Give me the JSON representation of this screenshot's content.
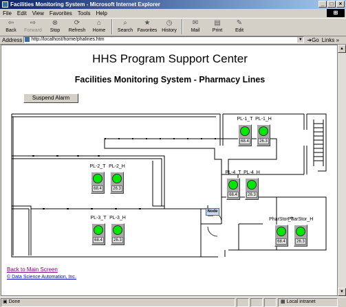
{
  "window": {
    "title": "Facilities Monitoring System - Microsoft Internet Explorer"
  },
  "menu": [
    "File",
    "Edit",
    "View",
    "Favorites",
    "Tools",
    "Help"
  ],
  "toolbar": {
    "back": "Back",
    "forward": "Forward",
    "stop": "Stop",
    "refresh": "Refresh",
    "home": "Home",
    "search": "Search",
    "favorites": "Favorites",
    "history": "History",
    "mail": "Mail",
    "print": "Print",
    "edit": "Edit"
  },
  "address": {
    "label": "Address",
    "url": "http://localhost/home/phalines.htm",
    "go": "Go",
    "links": "Links »"
  },
  "page": {
    "title": "HHS Program Support Center",
    "subtitle": "Facilities Monitoring System - Pharmacy Lines",
    "suspend_label": "Suspend Alarm",
    "node_label": "Node",
    "back_link": "Back to Main Screen",
    "copyright": "© Data Science Automation, Inc."
  },
  "sensors": [
    {
      "label": "PL-1_T",
      "value": "68.4",
      "status": "ok"
    },
    {
      "label": "PL-1_H",
      "value": "26.3",
      "status": "ok"
    },
    {
      "label": "PL-2_T",
      "value": "68.4",
      "status": "ok"
    },
    {
      "label": "PL-2_H",
      "value": "26.3",
      "status": "ok"
    },
    {
      "label": "PL-4_T",
      "value": "68.4",
      "status": "ok"
    },
    {
      "label": "PL-4_H",
      "value": "26.3",
      "status": "ok"
    },
    {
      "label": "PL-3_T",
      "value": "68.4",
      "status": "ok"
    },
    {
      "label": "PL-3_H",
      "value": "26.3",
      "status": "ok"
    },
    {
      "label": "PharStor_T",
      "value": "68.4",
      "status": "ok"
    },
    {
      "label": "PharStor_H",
      "value": "26.3",
      "status": "ok"
    }
  ],
  "status": {
    "text": "Done",
    "zone": "Local intranet"
  },
  "colors": {
    "ok": "#00e800",
    "titlebar": "#0a246a"
  }
}
